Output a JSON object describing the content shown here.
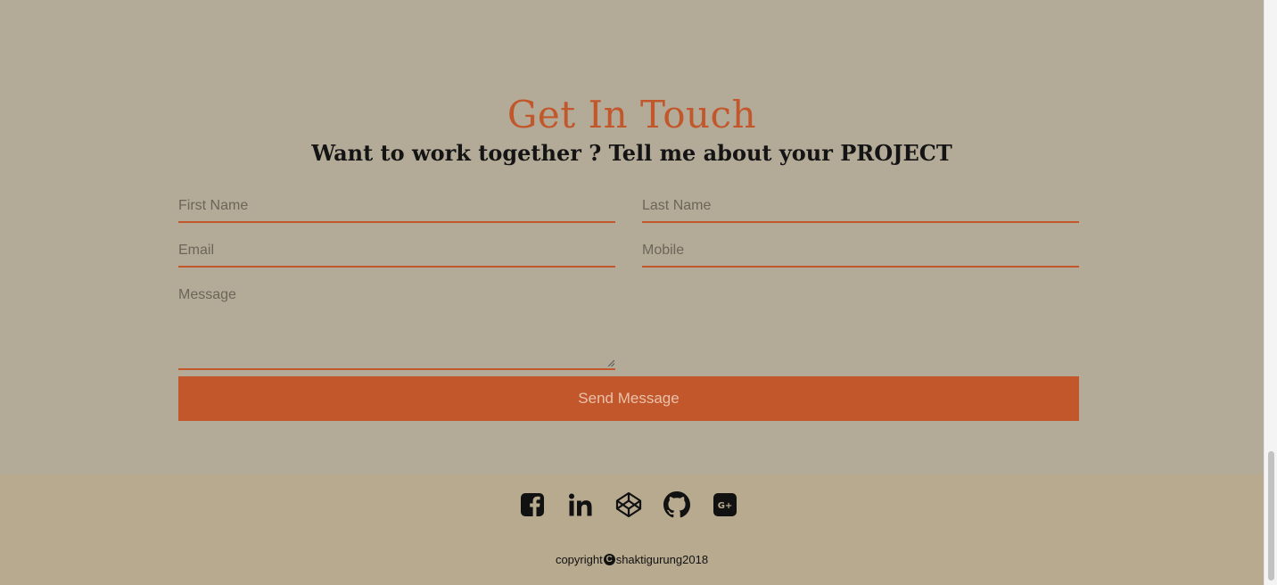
{
  "contact": {
    "title": "Get In Touch",
    "subtitle": "Want to work together ? Tell me about your PROJECT",
    "fields": {
      "first_name": "First Name",
      "last_name": "Last Name",
      "email": "Email",
      "mobile": "Mobile",
      "message": "Message"
    },
    "send_label": "Send Message"
  },
  "footer": {
    "socials": [
      "facebook-icon",
      "linkedin-icon",
      "codepen-icon",
      "github-icon",
      "google-plus-icon"
    ],
    "copyright_prefix": "copyright",
    "copyright_mark": "C",
    "copyright_suffix": "shaktigurung2018"
  },
  "colors": {
    "accent": "#c2572b",
    "background": "#b3ab98",
    "footer_background": "#b8aa8f"
  }
}
